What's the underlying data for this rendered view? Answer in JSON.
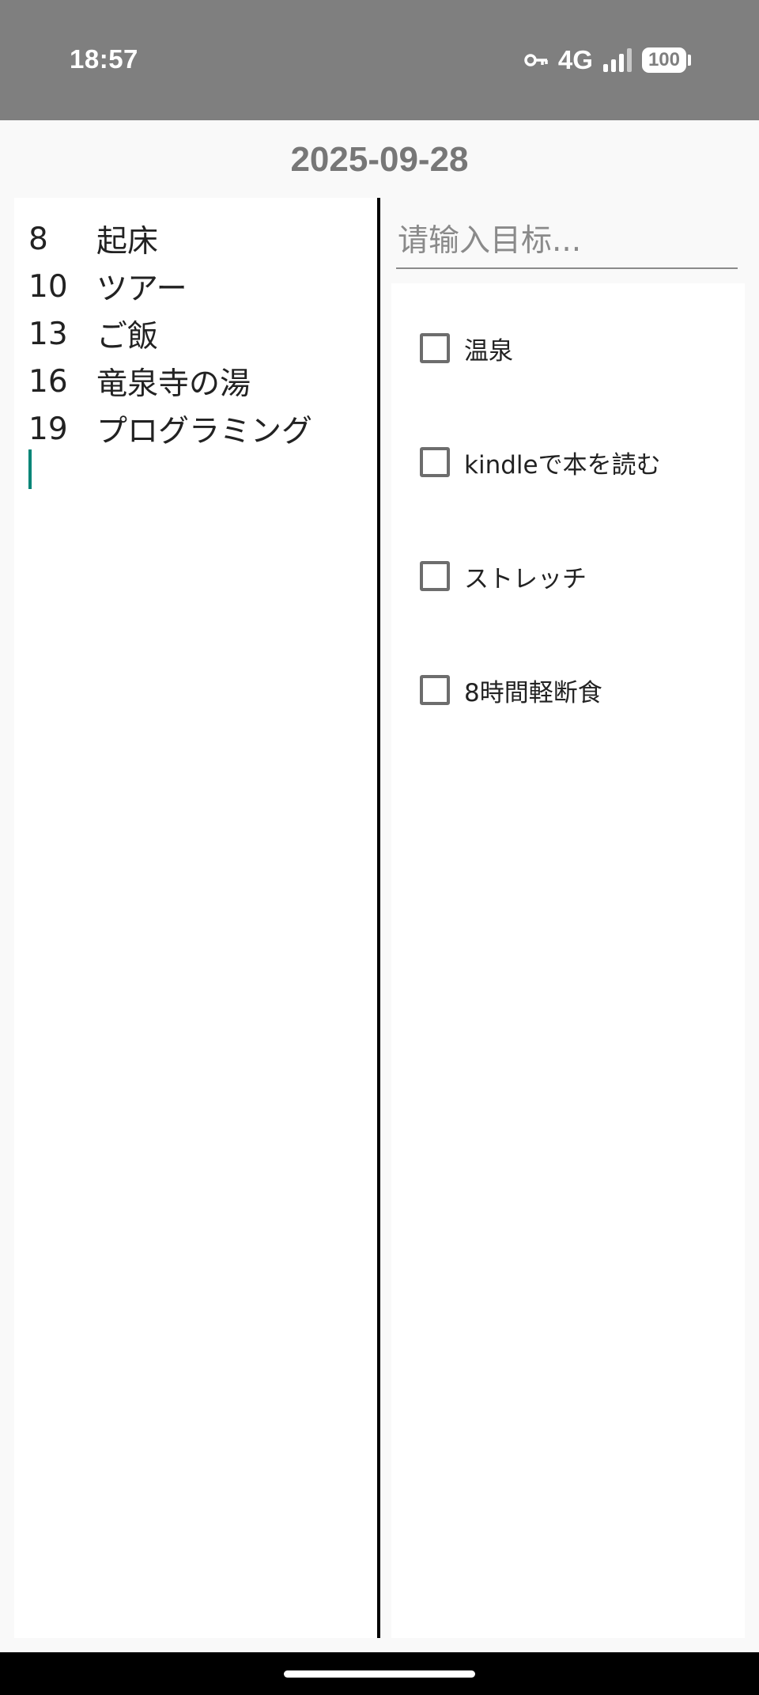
{
  "status_bar": {
    "time": "18:57",
    "network": "4G",
    "battery": "100",
    "icons": [
      "vpn-key-icon",
      "signal-icon",
      "battery-icon"
    ]
  },
  "header": {
    "date": "2025-09-28"
  },
  "schedule": {
    "items": [
      {
        "hour": "8",
        "activity": "起床"
      },
      {
        "hour": "10",
        "activity": "ツアー"
      },
      {
        "hour": "13",
        "activity": "ご飯"
      },
      {
        "hour": "16",
        "activity": "竜泉寺の湯"
      },
      {
        "hour": "19",
        "activity": "プログラミング"
      }
    ]
  },
  "goals": {
    "input_placeholder": "请输入目标...",
    "items": [
      {
        "label": "温泉",
        "checked": false
      },
      {
        "label": "kindleで本を読む",
        "checked": false
      },
      {
        "label": "ストレッチ",
        "checked": false
      },
      {
        "label": "8時間軽断食",
        "checked": false
      }
    ]
  },
  "colors": {
    "status_bar": "#7f7f7f",
    "caret": "#008577",
    "divider": "#000000"
  }
}
